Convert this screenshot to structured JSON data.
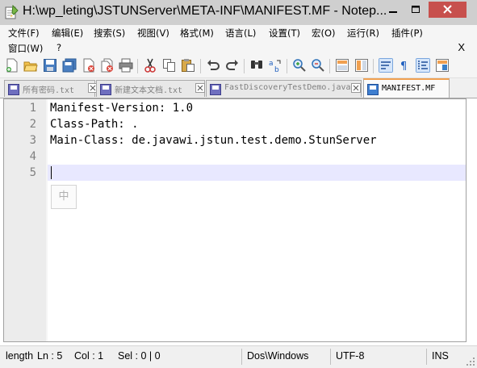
{
  "window": {
    "title": "H:\\wp_leting\\JSTUNServer\\META-INF\\MANIFEST.MF - Notep...",
    "icons": [
      "notepad-plus-icon",
      "minimize-icon",
      "maximize-icon",
      "close-icon"
    ]
  },
  "menu": {
    "items": [
      "文件(F)",
      "编辑(E)",
      "搜索(S)",
      "视图(V)",
      "格式(M)",
      "语言(L)",
      "设置(T)",
      "宏(O)",
      "运行(R)",
      "插件(P)"
    ],
    "row2": [
      "窗口(W)",
      "?"
    ],
    "close_doc": "X"
  },
  "toolbar": {
    "buttons": [
      "new-file",
      "open-file",
      "save",
      "save-all",
      "close",
      "close-all",
      "print",
      "cut",
      "copy",
      "paste",
      "undo",
      "redo",
      "find",
      "replace",
      "zoom-in",
      "zoom-out",
      "sync-v",
      "sync-h",
      "word-wrap",
      "show-all-chars",
      "indent-guide",
      "doc-map"
    ]
  },
  "tabs": [
    {
      "label": "所有密码.txt",
      "state": "unsaved"
    },
    {
      "label": "新建文本文档.txt",
      "state": "unsaved"
    },
    {
      "label": "FastDiscoveryTestDemo.java",
      "state": "unsaved"
    },
    {
      "label": "MANIFEST.MF",
      "state": "active"
    }
  ],
  "editor": {
    "line_numbers": [
      "1",
      "2",
      "3",
      "4",
      "5"
    ],
    "lines": [
      "Manifest-Version: 1.0",
      "Class-Path: .",
      "Main-Class: de.javawi.jstun.test.demo.StunServer",
      "",
      ""
    ],
    "current_line": 5,
    "ime_indicator": "中"
  },
  "status": {
    "length": "length",
    "ln": "Ln : 5",
    "col": "Col : 1",
    "sel": "Sel : 0 | 0",
    "eol": "Dos\\Windows",
    "encoding": "UTF-8",
    "mode": "INS"
  },
  "colors": {
    "titlebar": "#cfcfcf",
    "close_button": "#c7504d",
    "current_line": "#e8e8ff",
    "gutter": "#ececec",
    "line_number": "#808080",
    "active_tab_accent": "#f0a050"
  }
}
